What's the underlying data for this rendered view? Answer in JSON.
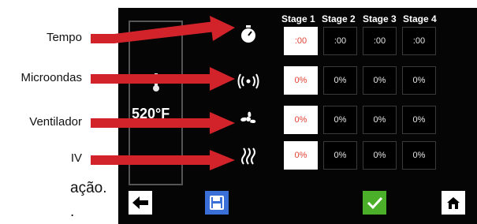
{
  "annotations": [
    {
      "label": "Tempo"
    },
    {
      "label": "Microondas"
    },
    {
      "label": "Ventilador"
    },
    {
      "label": "IV"
    }
  ],
  "fragments": [
    "ação.",
    "."
  ],
  "screen": {
    "temperature": "520°F",
    "stages": [
      "Stage 1",
      "Stage 2",
      "Stage 3",
      "Stage 4"
    ],
    "rows": [
      {
        "icon": "timer-icon",
        "values": [
          ":00",
          ":00",
          ":00",
          ":00"
        ]
      },
      {
        "icon": "microwave-waves-icon",
        "values": [
          "0%",
          "0%",
          "0%",
          "0%"
        ]
      },
      {
        "icon": "fan-icon",
        "values": [
          "0%",
          "0%",
          "0%",
          "0%"
        ]
      },
      {
        "icon": "infrared-heat-icon",
        "values": [
          "0%",
          "0%",
          "0%",
          "0%"
        ]
      }
    ],
    "buttons": [
      "back-arrow-icon",
      "save-disk-icon",
      "confirm-check-icon",
      "home-icon"
    ]
  },
  "colors": {
    "arrow": "#d2232a",
    "active_cell_text": "#e34234",
    "save": "#3a6fd8",
    "confirm": "#4caf2a"
  }
}
